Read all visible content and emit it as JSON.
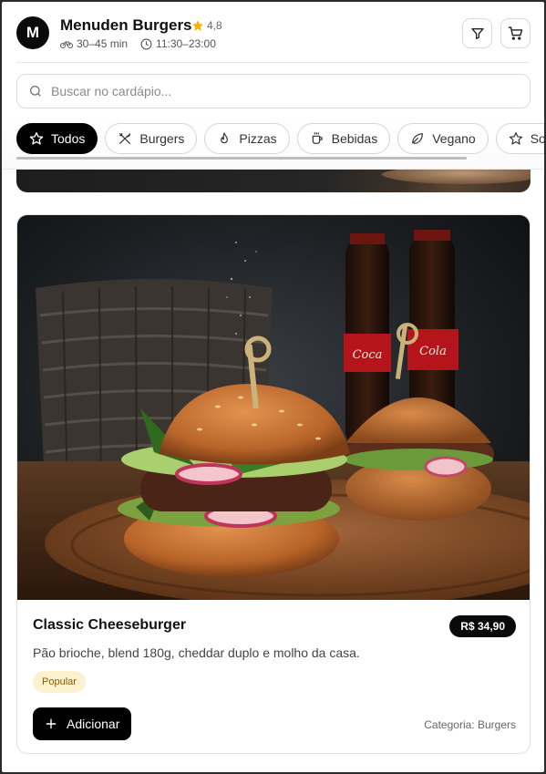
{
  "header": {
    "logo_letter": "M",
    "shop_name": "Menuden Burgers",
    "rating": "4,8",
    "delivery_time": "30–45 min",
    "opening_hours": "11:30–23:00",
    "icons": [
      "star-icon",
      "bike-icon",
      "clock-icon",
      "filter-icon",
      "cart-icon"
    ]
  },
  "search": {
    "placeholder": "Buscar no cardápio..."
  },
  "categories": [
    {
      "label": "Todos",
      "icon": "star-icon",
      "active": true
    },
    {
      "label": "Burgers",
      "icon": "utensils-icon",
      "active": false
    },
    {
      "label": "Pizzas",
      "icon": "flame-icon",
      "active": false
    },
    {
      "label": "Bebidas",
      "icon": "cup-icon",
      "active": false
    },
    {
      "label": "Vegano",
      "icon": "leaf-icon",
      "active": false
    },
    {
      "label": "Sobremesas",
      "icon": "star-icon",
      "active": false
    }
  ],
  "product": {
    "name": "Classic Cheeseburger",
    "price": "R$ 34,90",
    "description": "Pão brioche, blend 180g, cheddar duplo e molho da casa.",
    "badge": "Popular",
    "add_label": "Adicionar",
    "category_label": "Categoria:",
    "category_value": "Burgers",
    "photo": "cheeseburger-photo"
  },
  "colors": {
    "accent": "#000000",
    "rating_star": "#f5b301",
    "badge_bg": "#fdf2cf",
    "badge_text": "#8a5a00"
  }
}
